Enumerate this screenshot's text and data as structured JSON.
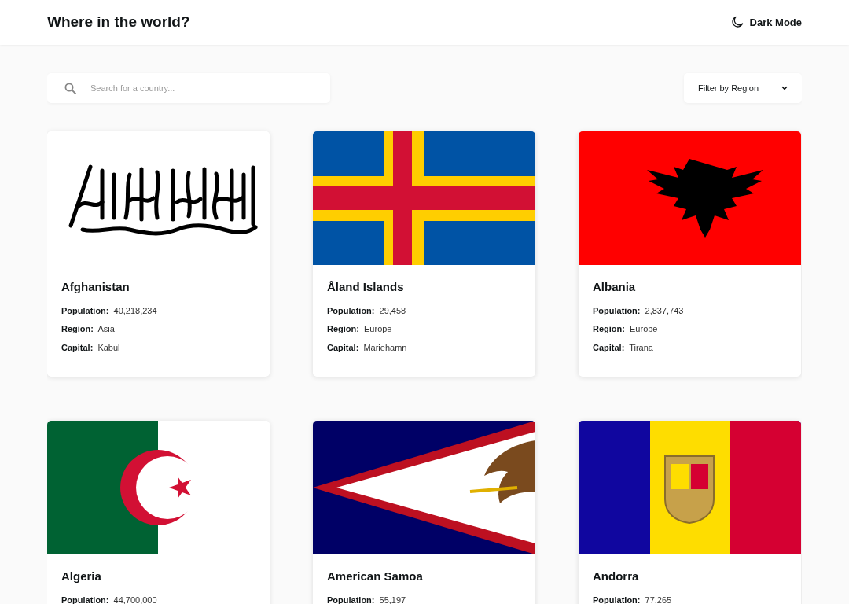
{
  "header": {
    "title": "Where in the world?",
    "theme_toggle": "Dark Mode"
  },
  "search": {
    "placeholder": "Search for a country..."
  },
  "filter": {
    "label": "Filter by Region"
  },
  "countries": [
    {
      "name": "Afghanistan",
      "kind": "afghanistan",
      "fields": [
        {
          "label": "Population:",
          "value": "40,218,234"
        },
        {
          "label": "Region:",
          "value": "Asia"
        },
        {
          "label": "Capital:",
          "value": "Kabul"
        }
      ]
    },
    {
      "name": "Åland Islands",
      "kind": "aland",
      "fields": [
        {
          "label": "Population:",
          "value": "29,458"
        },
        {
          "label": "Region:",
          "value": "Europe"
        },
        {
          "label": "Capital:",
          "value": "Mariehamn"
        }
      ]
    },
    {
      "name": "Albania",
      "kind": "albania",
      "fields": [
        {
          "label": "Population:",
          "value": "2,837,743"
        },
        {
          "label": "Region:",
          "value": "Europe"
        },
        {
          "label": "Capital:",
          "value": "Tirana"
        }
      ]
    },
    {
      "name": "Algeria",
      "kind": "algeria",
      "fields": [
        {
          "label": "Population:",
          "value": "44,700,000"
        }
      ]
    },
    {
      "name": "American Samoa",
      "kind": "american_samoa",
      "fields": [
        {
          "label": "Population:",
          "value": "55,197"
        }
      ]
    },
    {
      "name": "Andorra",
      "kind": "andorra",
      "fields": [
        {
          "label": "Population:",
          "value": "77,265"
        }
      ]
    }
  ]
}
